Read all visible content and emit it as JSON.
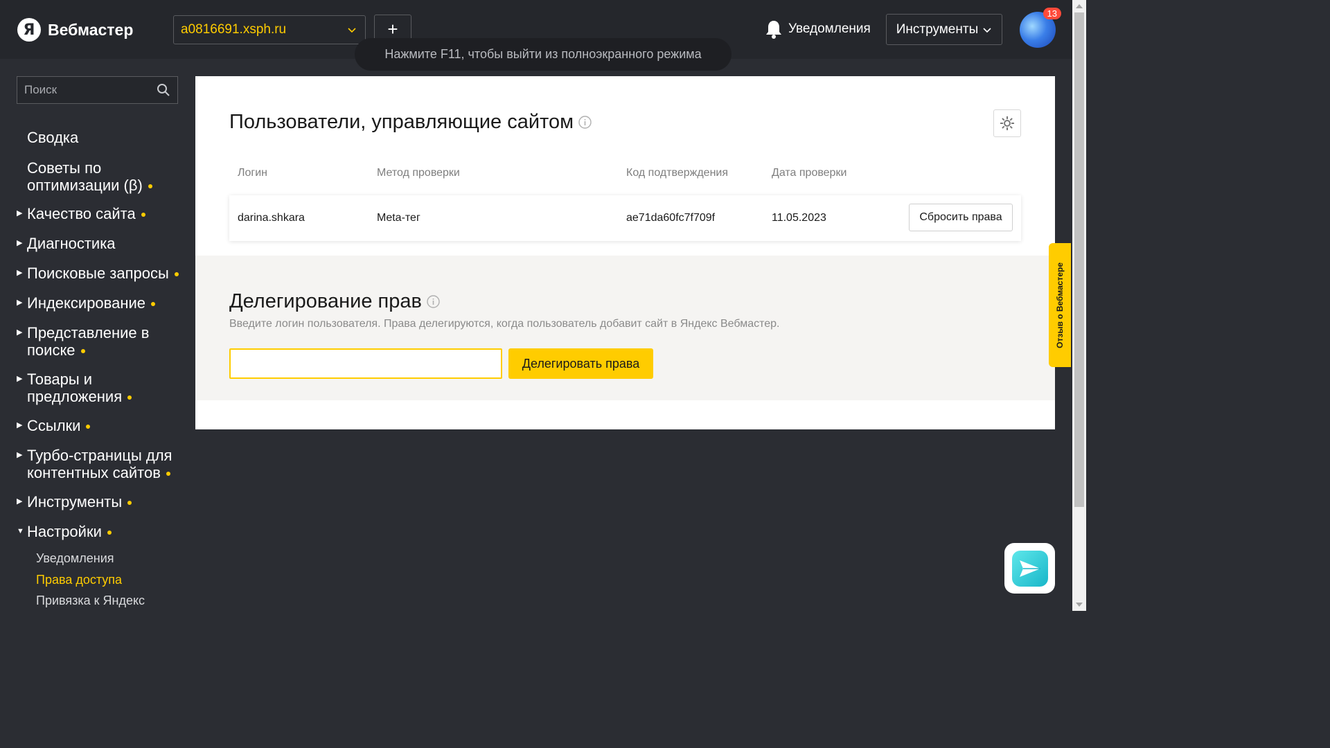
{
  "header": {
    "logo_letter": "Я",
    "logo_text": "Вебмастер",
    "site": "a0816691.xsph.ru",
    "add_label": "+",
    "notifications_label": "Уведомления",
    "tools_label": "Инструменты",
    "avatar_badge": "13"
  },
  "toast": "Нажмите F11, чтобы выйти из полноэкранного режима",
  "sidebar": {
    "search_placeholder": "Поиск",
    "items": [
      {
        "label": "Сводка",
        "arrow": false,
        "dot": false
      },
      {
        "label": "Советы по оптимизации (β)",
        "arrow": false,
        "dot": true
      },
      {
        "label": "Качество сайта",
        "arrow": true,
        "dot": true
      },
      {
        "label": "Диагностика",
        "arrow": true,
        "dot": false
      },
      {
        "label": "Поисковые запросы",
        "arrow": true,
        "dot": true
      },
      {
        "label": "Индексирование",
        "arrow": true,
        "dot": true
      },
      {
        "label": "Представление в поиске",
        "arrow": true,
        "dot": true
      },
      {
        "label": "Товары и предложения",
        "arrow": true,
        "dot": true
      },
      {
        "label": "Ссылки",
        "arrow": true,
        "dot": true
      },
      {
        "label": "Турбо-страницы для контентных сайтов",
        "arrow": true,
        "dot": true
      },
      {
        "label": "Инструменты",
        "arrow": true,
        "dot": true
      },
      {
        "label": "Настройки",
        "arrow": true,
        "dot": true,
        "expanded": true
      }
    ],
    "subitems": [
      {
        "label": "Уведомления",
        "active": false
      },
      {
        "label": "Права доступа",
        "active": true
      },
      {
        "label": "Привязка к Яндекс",
        "active": false
      }
    ]
  },
  "users_section": {
    "title": "Пользователи, управляющие сайтом",
    "columns": [
      "Логин",
      "Метод проверки",
      "Код подтверждения",
      "Дата проверки"
    ],
    "rows": [
      {
        "login": "darina.shkara",
        "method": "Meta-тег",
        "code": "ae71da60fc7f709f",
        "date": "11.05.2023",
        "action": "Сбросить права"
      }
    ]
  },
  "delegation": {
    "title": "Делегирование прав",
    "subtitle": "Введите логин пользователя. Права делегируются, когда пользователь добавит сайт в Яндекс Вебмастер.",
    "input_value": "",
    "button_label": "Делегировать права"
  },
  "feedback_tab": "Отзыв о Вебмастере",
  "colors": {
    "accent": "#ffcc00",
    "header_bg": "#25272c",
    "page_bg": "#2b2d33"
  }
}
